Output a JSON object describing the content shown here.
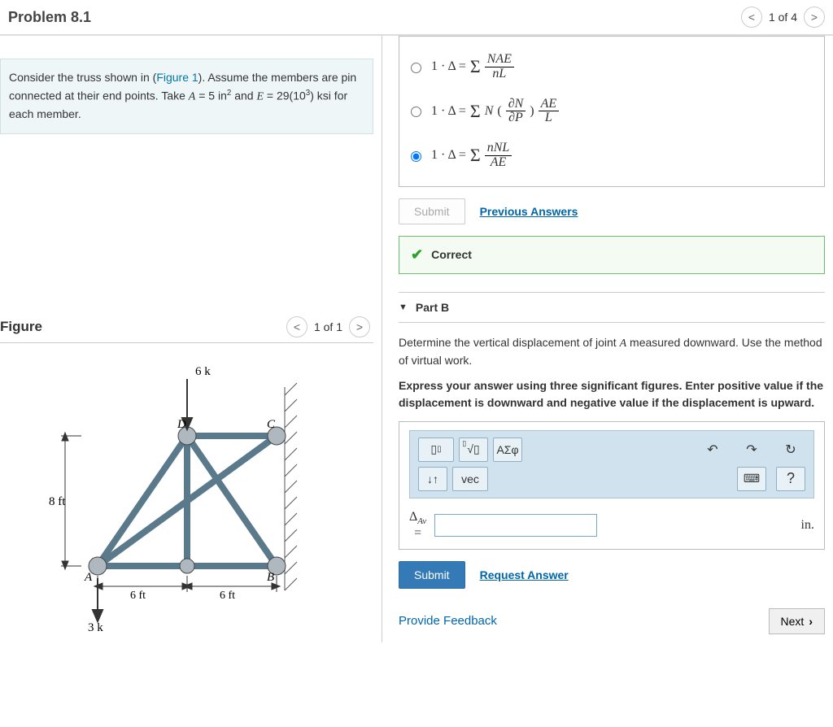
{
  "header": {
    "title": "Problem 8.1",
    "pager": {
      "prev": "<",
      "text": "1 of 4",
      "next": ">"
    }
  },
  "info": {
    "line1a": "Consider the truss shown in (",
    "figure_link": "Figure 1",
    "line1b": "). Assume the members are pin connected at their end points. Take ",
    "A_eq": "A",
    "eq_text": " = 5 in",
    "sq": "2",
    "and_text": " and ",
    "E_eq": "E",
    "e_val": " = 29(10",
    "cube": "3",
    "ksi": ") ksi for each member."
  },
  "figure": {
    "title": "Figure",
    "pager": {
      "prev": "<",
      "text": "1 of 1",
      "next": ">"
    },
    "labels": {
      "topload": "6 k",
      "D": "D",
      "C": "C",
      "height": "8 ft",
      "A": "A",
      "B": "B",
      "span1": "6 ft",
      "span2": "6 ft",
      "bottomload": "3 k"
    }
  },
  "partA": {
    "opt1": {
      "lhs": "1 · Δ =",
      "top": "NAE",
      "bot": "nL"
    },
    "opt2": {
      "lhs": "1 · Δ =",
      "mid": "N",
      "p1top": "∂N",
      "p1bot": "∂P",
      "p2top": "AE",
      "p2bot": "L"
    },
    "opt3": {
      "lhs": "1 · Δ =",
      "top": "nNL",
      "bot": "AE"
    },
    "submit": "Submit",
    "prev_answers": "Previous Answers",
    "correct": "Correct"
  },
  "partB": {
    "title": "Part B",
    "p1a": "Determine the vertical displacement of joint ",
    "p1j": "A",
    "p1b": " measured downward. Use the method of virtual work.",
    "p2": "Express your answer using three significant figures. Enter positive value if the displacement is downward and negative value if the displacement is upward.",
    "toolbar": {
      "sqrt": "√",
      "greek": "ΑΣφ",
      "undo": "↶",
      "redo": "↷",
      "reset": "↻",
      "updown": "↓↑",
      "vec": "vec",
      "keyboard": "⌨",
      "help": "?"
    },
    "input_label_top": "Δ",
    "input_label_sub": "Av",
    "input_eq": "=",
    "unit": "in.",
    "submit": "Submit",
    "request": "Request Answer"
  },
  "footer": {
    "feedback": "Provide Feedback",
    "next": "Next"
  }
}
